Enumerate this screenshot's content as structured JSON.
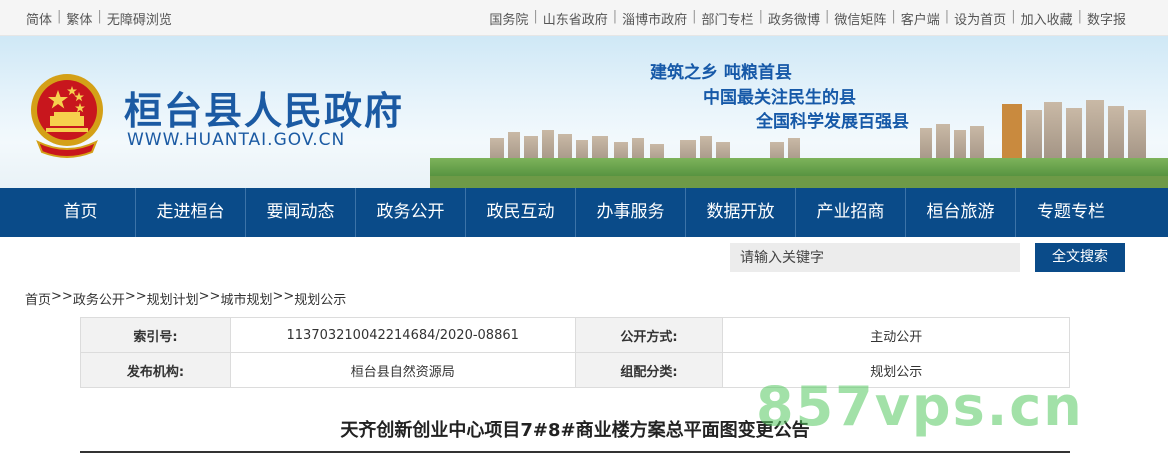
{
  "topbar": {
    "left_links": [
      "简体",
      "繁体",
      "无障碍浏览"
    ],
    "right_links": [
      "国务院",
      "山东省政府",
      "淄博市政府",
      "部门专栏",
      "政务微博",
      "微信矩阵",
      "客户端",
      "设为首页",
      "加入收藏",
      "数字报"
    ]
  },
  "banner": {
    "title": "桓台县人民政府",
    "url": "WWW.HUANTAI.GOV.CN",
    "slogans": [
      "建筑之乡 吨粮首县",
      "中国最关注民生的县",
      "全国科学发展百强县"
    ]
  },
  "nav": {
    "items": [
      "首页",
      "走进桓台",
      "要闻动态",
      "政务公开",
      "政民互动",
      "办事服务",
      "数据开放",
      "产业招商",
      "桓台旅游",
      "专题专栏"
    ]
  },
  "search": {
    "placeholder": "请输入关键字",
    "button": "全文搜索"
  },
  "breadcrumb": [
    "首页",
    "政务公开",
    "规划计划",
    "城市规划",
    "规划公示"
  ],
  "breadcrumb_separator": ">>",
  "meta": {
    "index_label": "索引号:",
    "index_value": "11370321004221468​4/2020-08861",
    "mode_label": "公开方式:",
    "mode_value": "主动公开",
    "publisher_label": "发布机构:",
    "publisher_value": "桓台县自然资源局",
    "category_label": "组配分类:",
    "category_value": "规划公示"
  },
  "article": {
    "title": "天齐创新创业中心项目7#8#商业楼方案总平面图变更公告"
  },
  "watermark": "857vps.cn",
  "colors": {
    "nav_bg": "#0a4b89",
    "brand_blue": "#1b5aa3"
  }
}
